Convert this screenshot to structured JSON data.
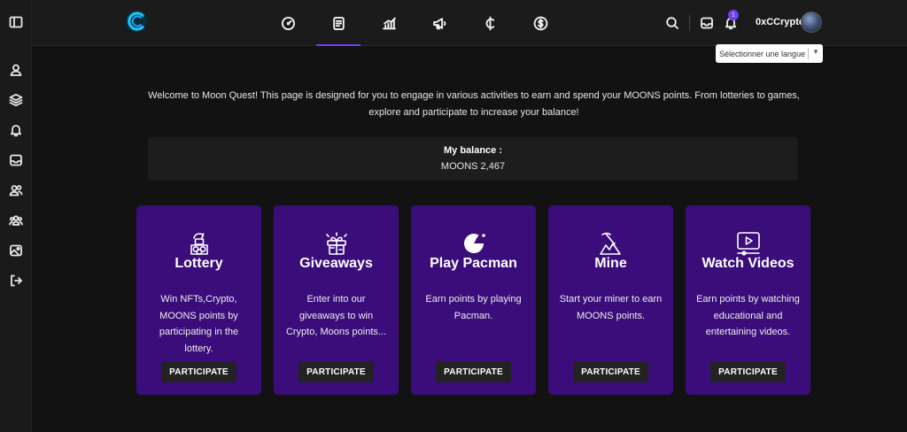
{
  "header": {
    "username": "0xCCrypto",
    "notification_count": "1"
  },
  "language_selector": {
    "label": "Sélectionner une langue",
    "arrow": "▼"
  },
  "intro": {
    "text": "Welcome to Moon Quest! This page is designed for you to engage in various activities to earn and spend your MOONS points. From lotteries to games, explore and participate to increase your balance!"
  },
  "balance": {
    "label": "My balance :",
    "value": "MOONS 2,467"
  },
  "cards": [
    {
      "icon": "lottery-icon",
      "title": "Lottery",
      "desc": "Win NFTs,Crypto, MOONS points by participating in the lottery.",
      "button": "PARTICIPATE"
    },
    {
      "icon": "gift-icon",
      "title": "Giveaways",
      "desc": "Enter into our giveaways to win Crypto, Moons points...",
      "button": "PARTICIPATE"
    },
    {
      "icon": "pacman-icon",
      "title": "Play Pacman",
      "desc": "Earn points by playing Pacman.",
      "button": "PARTICIPATE"
    },
    {
      "icon": "pickaxe-icon",
      "title": "Mine",
      "desc": "Start your miner to earn MOONS points.",
      "button": "PARTICIPATE"
    },
    {
      "icon": "video-icon",
      "title": "Watch Videos",
      "desc": "Earn points by watching educational and entertaining videos.",
      "button": "PARTICIPATE"
    }
  ],
  "colors": {
    "accent": "#6c3ff2",
    "card_bg": "#3a0d7a",
    "page_bg": "#121212"
  }
}
